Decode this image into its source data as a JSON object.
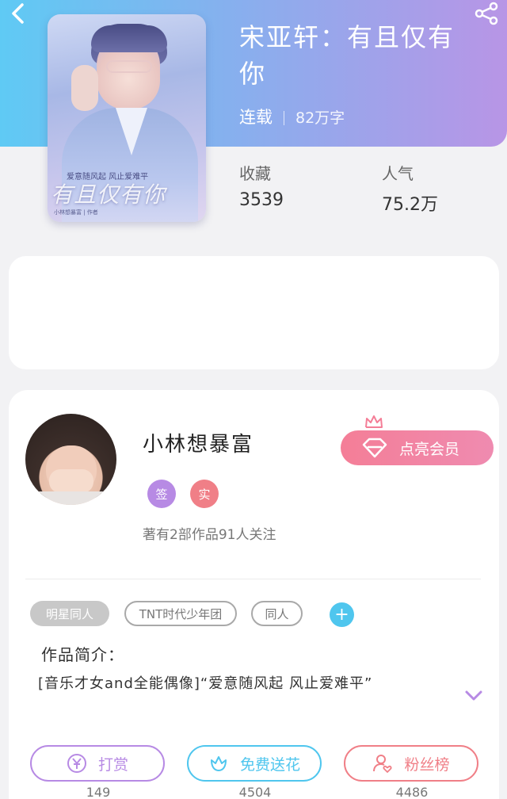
{
  "book": {
    "title": "宋亚轩：有且仅有你",
    "status": "连载",
    "word_count": "82万字",
    "favorites_label": "收藏",
    "favorites_value": "3539",
    "popularity_label": "人气",
    "popularity_value": "75.2万",
    "cover": {
      "tagline": "爱意随风起 风止爱难平",
      "title_art": "有且仅有你",
      "credits": "小林想暴富 | 作者"
    }
  },
  "author": {
    "name": "小林想暴富",
    "badges": [
      "签",
      "实"
    ],
    "info": "著有2部作品91人关注",
    "vip_button": "点亮会员"
  },
  "tags": [
    "明星同人",
    "TNT时代少年团",
    "同人"
  ],
  "tag_add_symbol": "+",
  "intro": {
    "label": "作品简介：",
    "text": "[音乐才女and全能偶像]“爱意随风起 风止爱难平”"
  },
  "actions": [
    {
      "label": "打赏",
      "count": "149",
      "icon": "yen-icon",
      "color": "#b78ae4"
    },
    {
      "label": "免费送花",
      "count": "4504",
      "icon": "flower-icon",
      "color": "#4fc6ee"
    },
    {
      "label": "粉丝榜",
      "count": "4486",
      "icon": "user-heart-icon",
      "color": "#f07f87"
    }
  ],
  "colors": {
    "header_start": "#5fcaf4",
    "header_end": "#b895e6",
    "vip": "#f47e97",
    "badge_sign": "#b78ae4",
    "badge_real": "#f07f87",
    "tag_add": "#4fc6ee"
  }
}
